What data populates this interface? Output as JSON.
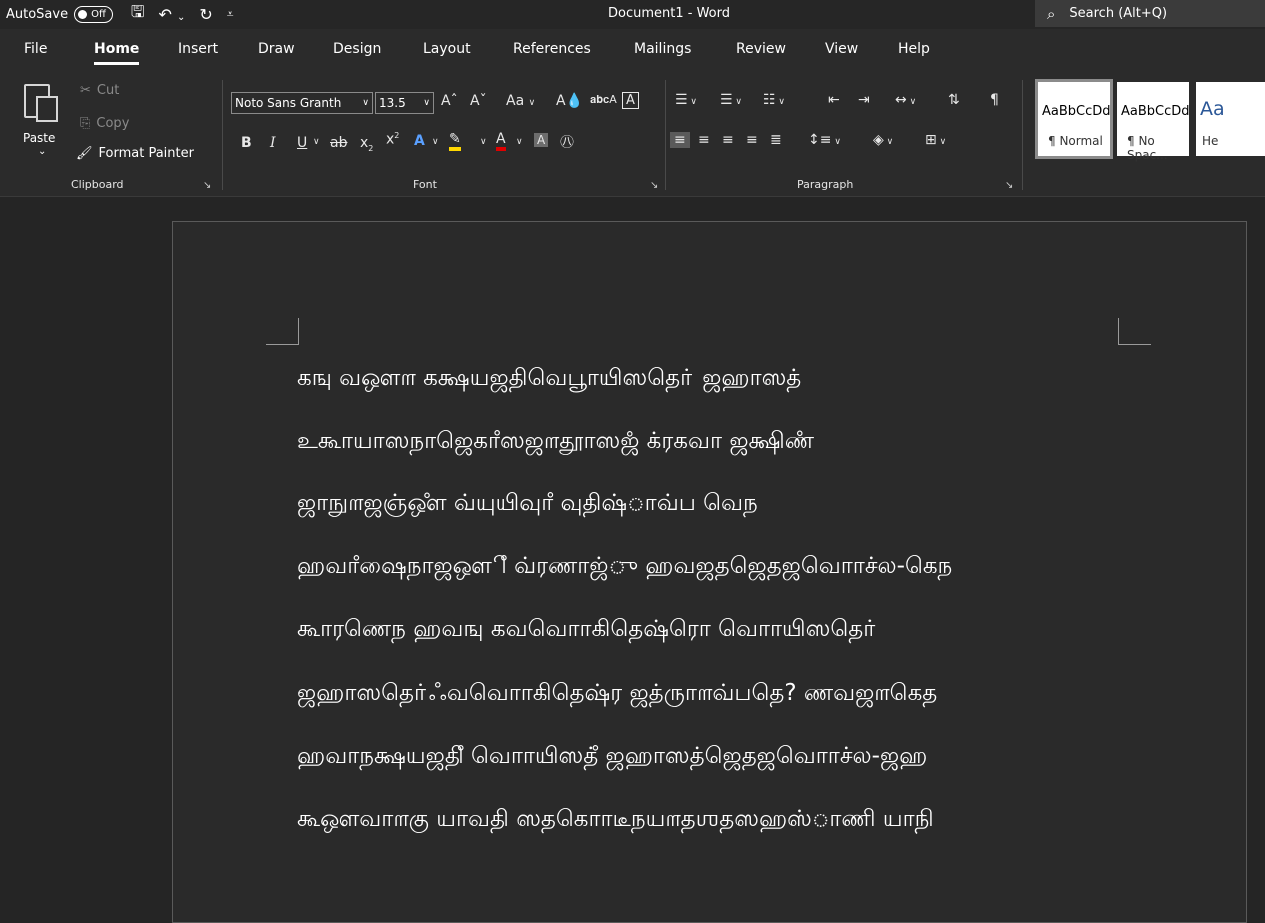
{
  "titlebar": {
    "autosave_label": "AutoSave",
    "autosave_state": "Off",
    "doc_title": "Document1  -  Word",
    "search_placeholder": "Search (Alt+Q)"
  },
  "tabs": [
    "File",
    "Home",
    "Insert",
    "Draw",
    "Design",
    "Layout",
    "References",
    "Mailings",
    "Review",
    "View",
    "Help"
  ],
  "active_tab": "Home",
  "clipboard": {
    "paste_label": "Paste",
    "cut_label": "Cut",
    "copy_label": "Copy",
    "format_painter_label": "Format Painter",
    "group_label": "Clipboard"
  },
  "font": {
    "font_name": "Noto Sans Granth",
    "font_size": "13.5",
    "case_label": "Aa",
    "group_label": "Font"
  },
  "paragraph": {
    "group_label": "Paragraph"
  },
  "styles": [
    {
      "sample": "AaBbCcDd",
      "name": "¶ Normal"
    },
    {
      "sample": "AaBbCcDd",
      "name": "¶ No Spac..."
    },
    {
      "sample": "Aa",
      "name": "He"
    }
  ],
  "colors": {
    "ribbon_bg": "#2b2b2b",
    "doc_bg": "#252525",
    "highlight_yellow": "#ffd700",
    "font_color_red": "#e00000"
  },
  "document": {
    "lines": [
      "கஙு வஔ௱ கக்ஷயஜதிவெபூாயிஸதொ் ஜஹாஸத்",
      "உகூாயாஸநாஜெகாஂஸஜ௱தூாஸஜஂ க்ரகவா ஜக்ஷிணஂ",
      "ஜாநு௱ஜஞ்ஔஂ வ்யுயிவுாஂ வுதிஷ்ாவ்ப வெந",
      "ஹவாஂஷைநாஜஔிஂ வ்ரணாஜ்ு ஹவஜதஜெதஜவொாச்ல-கெந",
      "கூாரணெந ஹவஙு கவவொாகிதெஷ்ரொ வொாயிஸதொ்",
      "ஜஹாஸதொ்ஃவவொாகிதெஷ்ர ஜத்ருா௱வ்பதெ? ணவஜ௱கெத",
      "ஹவாநக்ஷயஜதிஂ வொாயிஸத்ஂ ஜஹாஸத்ஜெதஜவொாச்ல-ஜஹ",
      "கூஔவா௱கு யாவதி ஸதகொாடீநய௱தஶதஸஹஸ்ாணி யாநி"
    ]
  }
}
